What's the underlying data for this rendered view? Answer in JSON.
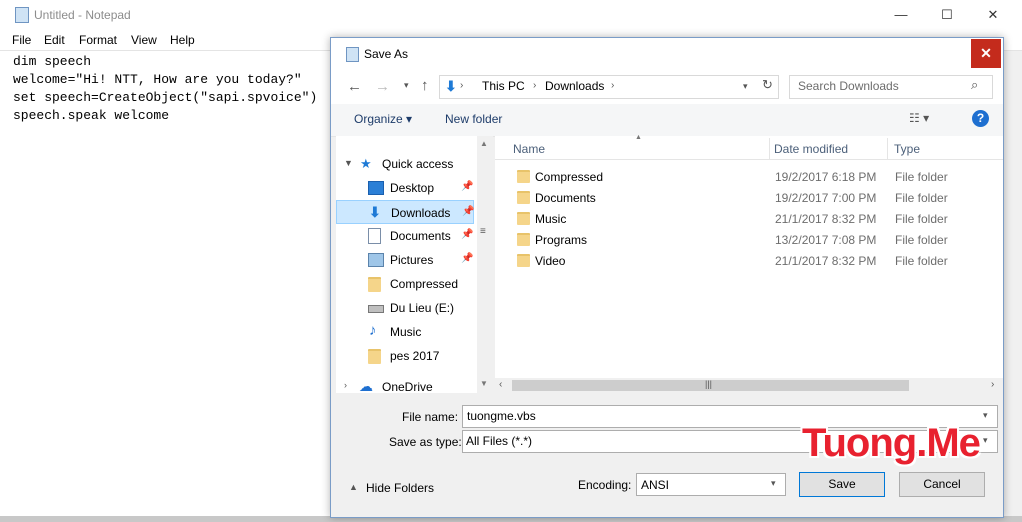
{
  "notepad": {
    "title": "Untitled - Notepad",
    "menu": [
      "File",
      "Edit",
      "Format",
      "View",
      "Help"
    ],
    "lines": [
      "dim speech",
      "welcome=\"Hi! NTT, How are you today?\"",
      "set speech=CreateObject(\"sapi.spvoice\")",
      "speech.speak welcome"
    ],
    "win_buttons": {
      "min": "—",
      "max": "☐",
      "close": "✕"
    }
  },
  "dialog": {
    "title": "Save As",
    "close_glyph": "✕",
    "breadcrumb": [
      "This PC",
      "Downloads"
    ],
    "search_placeholder": "Search Downloads",
    "toolbar": {
      "organize": "Organize ▾",
      "new_folder": "New folder"
    },
    "nav": [
      {
        "label": "Quick access",
        "icon": "star-icon",
        "pinned": false
      },
      {
        "label": "Desktop",
        "icon": "desktop-icon",
        "pinned": true
      },
      {
        "label": "Downloads",
        "icon": "download-arrow-icon",
        "pinned": true,
        "selected": true
      },
      {
        "label": "Documents",
        "icon": "document-icon",
        "pinned": true
      },
      {
        "label": "Pictures",
        "icon": "picture-icon",
        "pinned": true
      },
      {
        "label": "Compressed",
        "icon": "folder-icon",
        "pinned": false
      },
      {
        "label": "Du Lieu (E:)",
        "icon": "drive-icon",
        "pinned": false
      },
      {
        "label": "Music",
        "icon": "music-note-icon",
        "pinned": false
      },
      {
        "label": "pes 2017",
        "icon": "folder-icon",
        "pinned": false
      },
      {
        "label": "OneDrive",
        "icon": "cloud-icon",
        "pinned": false
      }
    ],
    "columns": {
      "name": "Name",
      "date": "Date modified",
      "type": "Type"
    },
    "files": [
      {
        "name": "Compressed",
        "date": "19/2/2017 6:18 PM",
        "type": "File folder"
      },
      {
        "name": "Documents",
        "date": "19/2/2017 7:00 PM",
        "type": "File folder"
      },
      {
        "name": "Music",
        "date": "21/1/2017 8:32 PM",
        "type": "File folder"
      },
      {
        "name": "Programs",
        "date": "13/2/2017 7:08 PM",
        "type": "File folder"
      },
      {
        "name": "Video",
        "date": "21/1/2017 8:32 PM",
        "type": "File folder"
      }
    ],
    "filename_label": "File name:",
    "filename_value": "tuongme.vbs",
    "savetype_label": "Save as type:",
    "savetype_value": "All Files  (*.*)",
    "hide_folders": "Hide Folders",
    "encoding_label": "Encoding:",
    "encoding_value": "ANSI",
    "save": "Save",
    "cancel": "Cancel"
  },
  "watermark": "Tuong.Me"
}
